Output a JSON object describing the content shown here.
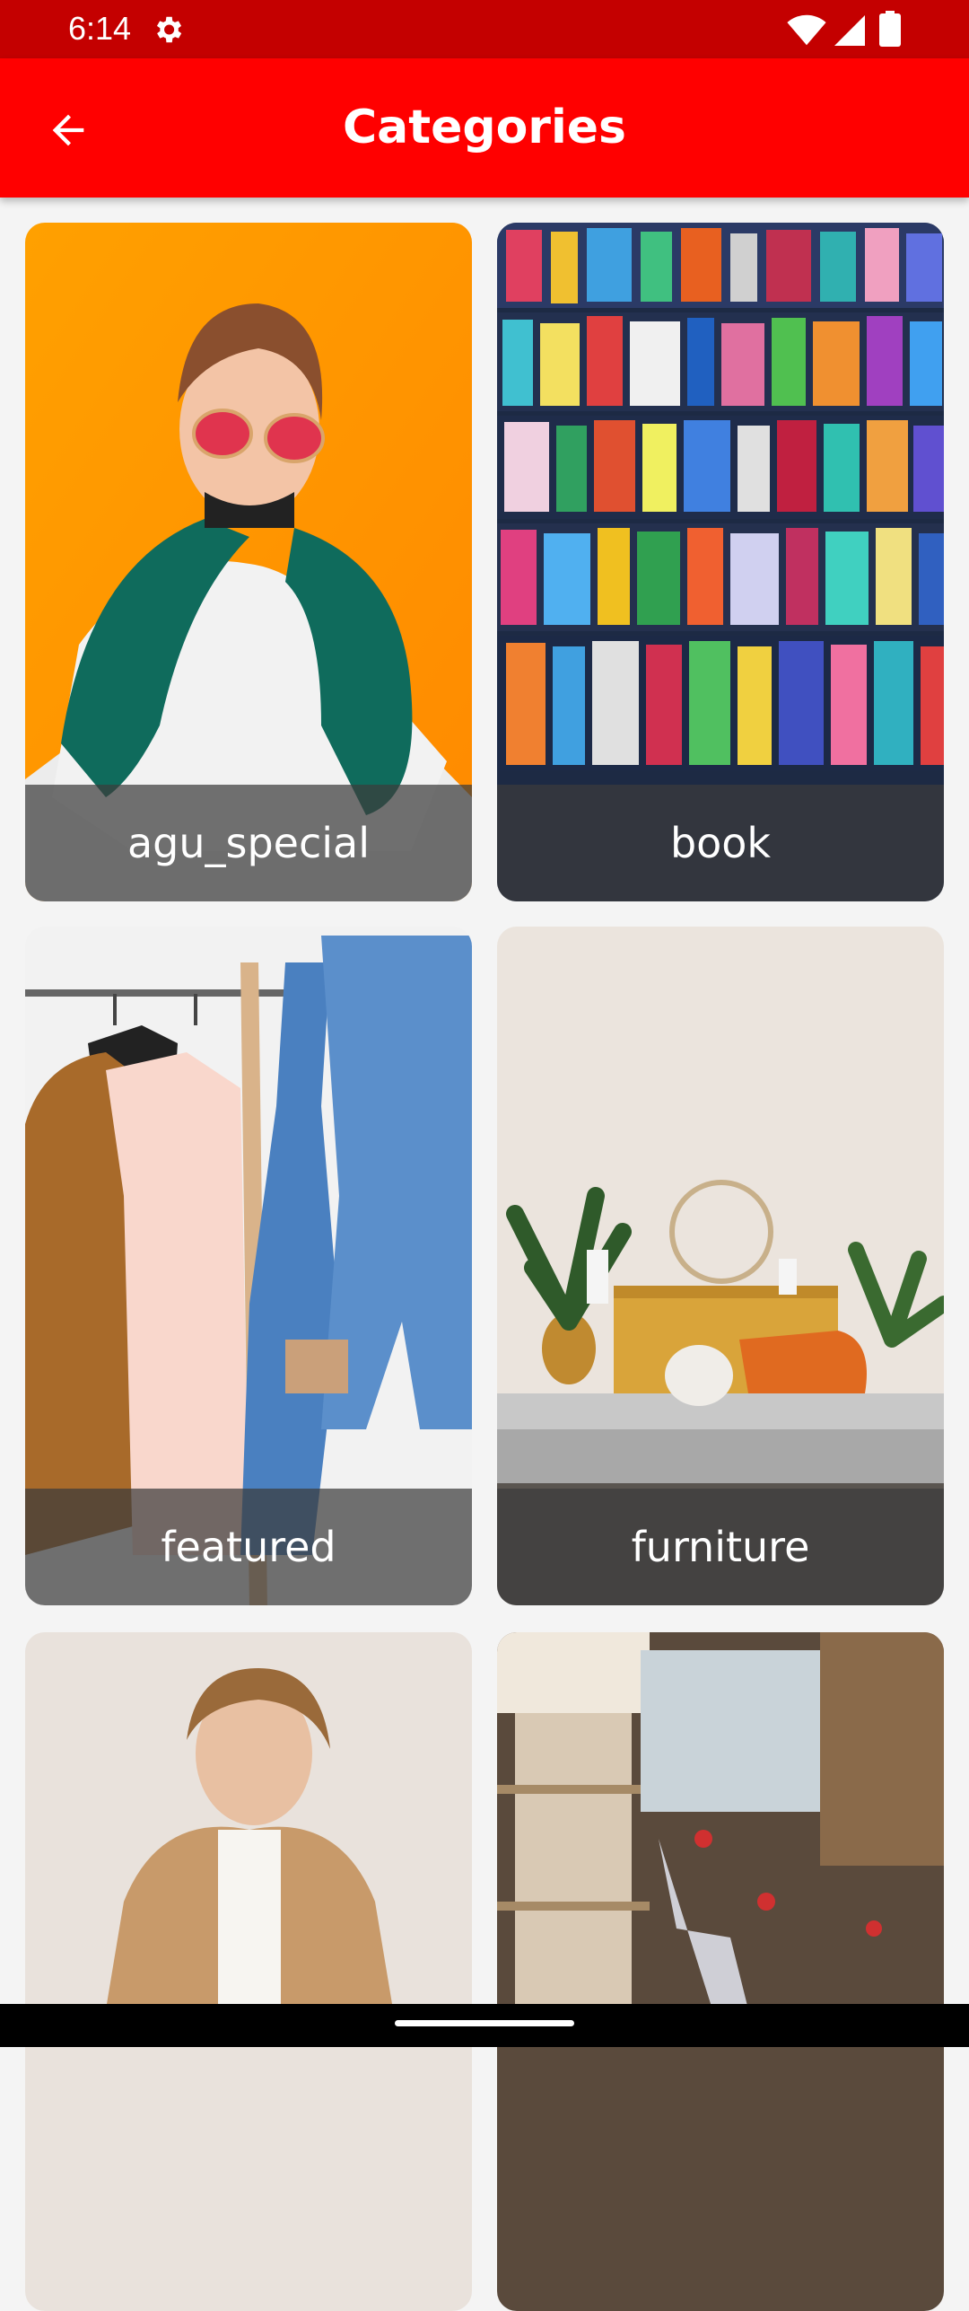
{
  "status_bar": {
    "time": "6:14",
    "icons": [
      "gear-icon",
      "wifi-icon",
      "signal-icon",
      "battery-icon"
    ],
    "background": "#c40000"
  },
  "app_bar": {
    "title": "Categories",
    "back_icon": "arrow-left-icon",
    "background": "#ff0000"
  },
  "categories": [
    {
      "label": "agu_special"
    },
    {
      "label": "book"
    },
    {
      "label": "featured"
    },
    {
      "label": "furniture"
    },
    {
      "label": ""
    },
    {
      "label": ""
    }
  ]
}
